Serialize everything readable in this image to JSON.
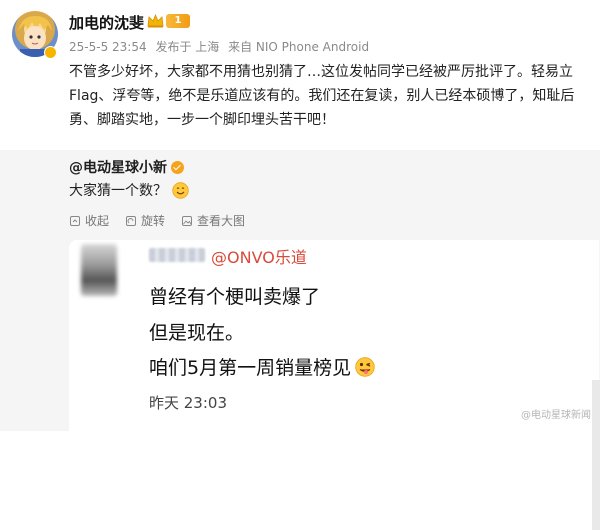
{
  "post": {
    "username": "加电的沈斐",
    "level": "1",
    "meta": {
      "date": "25-5-5 23:54",
      "location": "发布于 上海",
      "source": "来自 NIO Phone Android"
    },
    "text_lines": [
      "不管多少好坏，大家都不用猜也别猜了…这位发帖同学已经被严厉批评了。轻易立",
      "Flag、浮夸等，绝不是乐道应该有的。我们还在复读，别人已经本硕博了，知耻后",
      "勇、脚踏实地，一步一个脚印埋头苦干吧！"
    ]
  },
  "repost": {
    "author": "@电动星球小新",
    "text": "大家猜一个数？",
    "toolbar": {
      "collect_label": "收起",
      "rotate_label": "旋转",
      "view_large_label": "查看大图"
    }
  },
  "image": {
    "brand_name": "@ONVO乐道",
    "lines": [
      "曾经有个梗叫卖爆了",
      "但是现在。",
      "咱们5月第一周销量榜见"
    ],
    "time": "昨天 23:03",
    "watermark": "@电动星球新闻"
  },
  "colors": {
    "brand_red": "#d84a3a",
    "gold": "#f7b500",
    "repost_bg": "#f5f5f5"
  }
}
